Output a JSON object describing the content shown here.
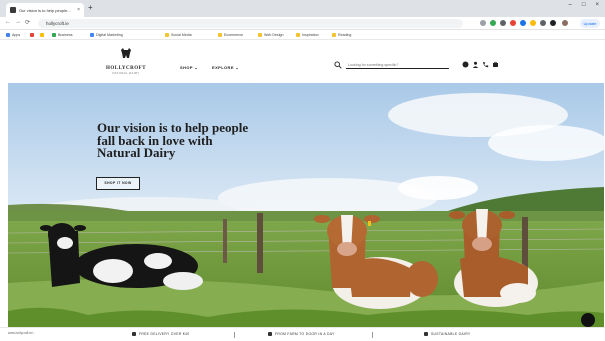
{
  "browser": {
    "tab_title": "Our vision is to help people...",
    "tab_close": "×",
    "new_tab": "+",
    "window_controls": [
      "–",
      "□",
      "×"
    ],
    "url": "hollycroft.ie",
    "nav": {
      "back": "←",
      "forward": "→",
      "reload": "⟳"
    },
    "update_label": "Update",
    "bookmarks": [
      {
        "label": "Apps",
        "color": "#4285f4"
      },
      {
        "label": "",
        "color": "#ea4335"
      },
      {
        "label": "",
        "color": "#fbbc05"
      },
      {
        "label": "Business",
        "color": "#34a853"
      },
      {
        "label": "Digital Marketing",
        "color": "#4285f4"
      },
      {
        "label": "Social Media",
        "color": "#f4c430"
      },
      {
        "label": "Ecommerce",
        "color": "#f4c430"
      },
      {
        "label": "Web Design",
        "color": "#f4c430"
      },
      {
        "label": "Inspiration",
        "color": "#f4c430"
      },
      {
        "label": "Reading",
        "color": "#f4c430"
      }
    ]
  },
  "site": {
    "logo_name": "HOLLYCROFT",
    "logo_sub": "NATURAL DAIRY",
    "nav": [
      {
        "label": "SHOP ⌄"
      },
      {
        "label": "EXPLORE ⌄"
      }
    ],
    "search_placeholder": "Looking for something specific?",
    "icons": [
      "account-icon",
      "user-icon",
      "phone-icon",
      "cart-icon"
    ]
  },
  "hero": {
    "headline": "Our vision is to help people fall back in love with Natural Dairy",
    "cta_label": "SHOP IT NOW"
  },
  "strip": {
    "status": "www.hollycroft.ie/...",
    "items": [
      {
        "label": "FREE DELIVERY OVER €40"
      },
      {
        "label": "FROM FARM TO DOOR IN A DAY"
      },
      {
        "label": "SUSTAINABLE DAIRY"
      }
    ]
  },
  "colors": {
    "sky": "#c9dff2",
    "grass": "#6f9a3c",
    "brown_cow": "#b0642f",
    "black_cow": "#151515"
  }
}
